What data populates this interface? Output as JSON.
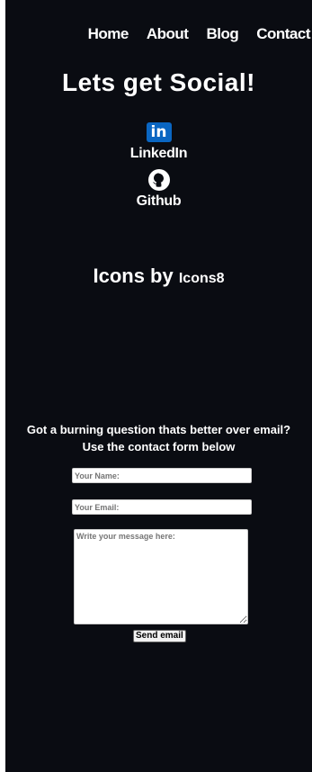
{
  "nav": {
    "items": [
      {
        "label": "Home"
      },
      {
        "label": "About"
      },
      {
        "label": "Blog"
      },
      {
        "label": "Contact"
      }
    ]
  },
  "social": {
    "title": "Lets get Social!",
    "linkedin": {
      "icon_text": "in",
      "label": "LinkedIn",
      "icon": "linkedin-icon"
    },
    "github": {
      "label": "Github",
      "icon": "github-icon"
    }
  },
  "credit": {
    "prefix": "Icons by",
    "link": "Icons8"
  },
  "contact": {
    "question_line1": "Got a burning question thats better over email?",
    "question_line2": "Use the contact form below",
    "name_placeholder": "Your Name:",
    "email_placeholder": "Your Email:",
    "message_placeholder": "Write your message here:",
    "send_label": "Send email"
  },
  "colors": {
    "background": "#0a0c12",
    "text": "#ffffff",
    "linkedin": "#0a66c2"
  }
}
